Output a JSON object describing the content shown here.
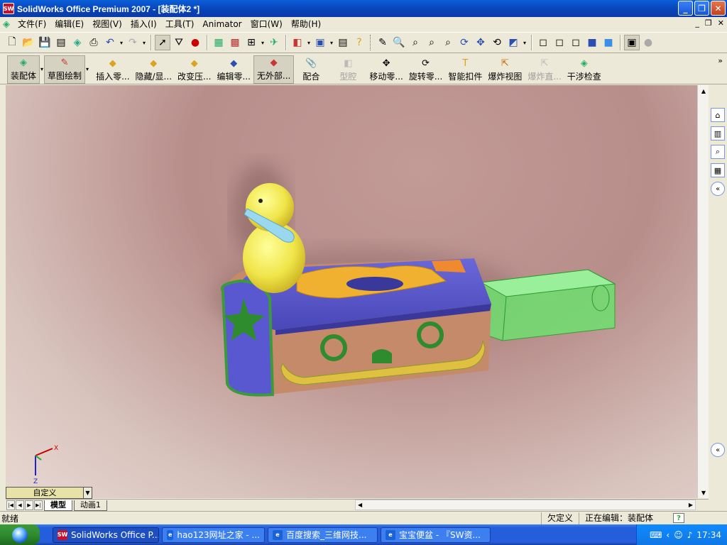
{
  "window": {
    "title": "SolidWorks Office Premium 2007 - [装配体2 *]",
    "app_icon": "SW"
  },
  "menu": [
    "文件(F)",
    "编辑(E)",
    "视图(V)",
    "插入(I)",
    "工具(T)",
    "Animator",
    "窗口(W)",
    "帮助(H)"
  ],
  "commands": [
    {
      "label": "装配体",
      "state": "selected"
    },
    {
      "label": "草图绘制",
      "state": "selected"
    },
    {
      "label": "插入零...",
      "state": "normal"
    },
    {
      "label": "隐藏/显...",
      "state": "normal"
    },
    {
      "label": "改变压...",
      "state": "normal"
    },
    {
      "label": "编辑零...",
      "state": "normal"
    },
    {
      "label": "无外部...",
      "state": "selected"
    },
    {
      "label": "配合",
      "state": "normal"
    },
    {
      "label": "型腔",
      "state": "disabled"
    },
    {
      "label": "移动零...",
      "state": "normal"
    },
    {
      "label": "旋转零...",
      "state": "normal"
    },
    {
      "label": "智能扣件",
      "state": "normal"
    },
    {
      "label": "爆炸视图",
      "state": "normal"
    },
    {
      "label": "爆炸直...",
      "state": "disabled"
    },
    {
      "label": "干涉检查",
      "state": "normal"
    }
  ],
  "view": {
    "orientation_label": "自定义",
    "triad_labels": {
      "x": "X",
      "y": "Y",
      "z": "Z"
    }
  },
  "tabs": [
    {
      "label": "模型",
      "active": true
    },
    {
      "label": "动画1",
      "active": false
    }
  ],
  "status": {
    "left": "就绪",
    "defined": "欠定义",
    "editing": "正在编辑：装配体"
  },
  "taskbar": {
    "items": [
      {
        "label": "SolidWorks Office P...",
        "active": true,
        "icon": "solidworks-icon",
        "color": "#c8102e"
      },
      {
        "label": "hao123网址之家 - ...",
        "active": false,
        "icon": "ie-icon",
        "color": "#1a62d8"
      },
      {
        "label": "百度搜索_三维网技...",
        "active": false,
        "icon": "ie-icon",
        "color": "#1a62d8"
      },
      {
        "label": "宝宝便盆 - 『SW资...",
        "active": false,
        "icon": "ie-icon",
        "color": "#1a62d8"
      }
    ],
    "time": "17:34"
  }
}
